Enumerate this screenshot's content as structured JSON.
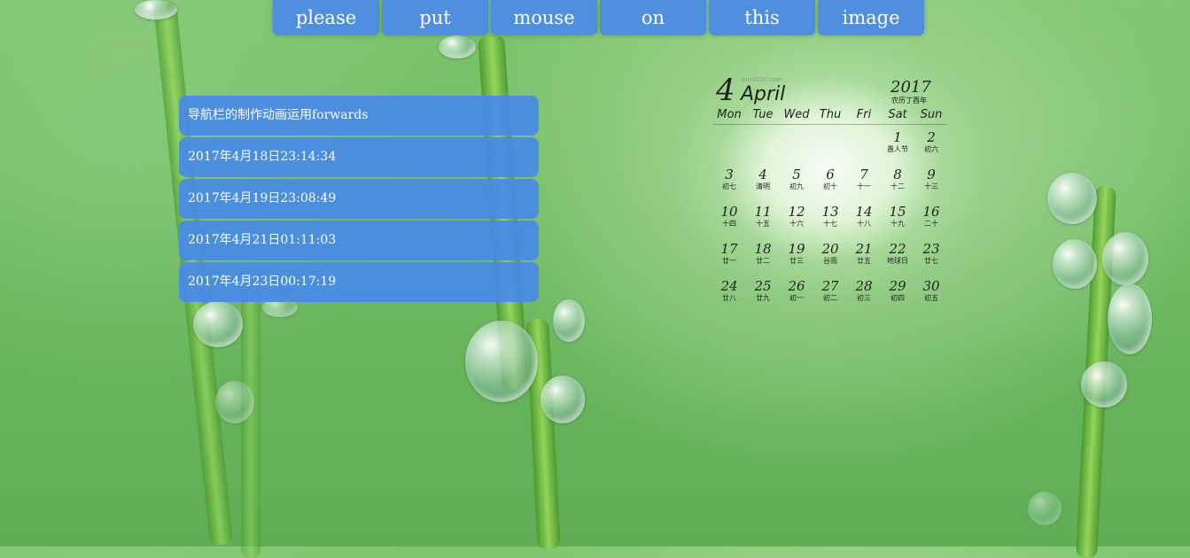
{
  "nav": {
    "buttons": [
      "please",
      "put",
      "mouse",
      "on",
      "this",
      "image"
    ]
  },
  "list": {
    "items": [
      "导航栏的制作动画运用forwards",
      "2017年4月18日23:14:34",
      "2017年4月19日23:08:49",
      "2017年4月21日01:11:03",
      "2017年4月23日00:17:19"
    ]
  },
  "calendar": {
    "month_num": "4",
    "month_name": "April",
    "watermark": "win4000.com",
    "year": "2017",
    "year_sub": "农历丁酉年",
    "weekdays": [
      "Mon",
      "Tue",
      "Wed",
      "Thu",
      "Fri",
      "Sat",
      "Sun"
    ],
    "rows": [
      [
        [
          "",
          ""
        ],
        [
          "",
          ""
        ],
        [
          "",
          ""
        ],
        [
          "",
          ""
        ],
        [
          "",
          ""
        ],
        [
          "1",
          "愚人节"
        ],
        [
          "2",
          "初六"
        ]
      ],
      [
        [
          "3",
          "初七"
        ],
        [
          "4",
          "清明"
        ],
        [
          "5",
          "初九"
        ],
        [
          "6",
          "初十"
        ],
        [
          "7",
          "十一"
        ],
        [
          "8",
          "十二"
        ],
        [
          "9",
          "十三"
        ]
      ],
      [
        [
          "10",
          "十四"
        ],
        [
          "11",
          "十五"
        ],
        [
          "12",
          "十六"
        ],
        [
          "13",
          "十七"
        ],
        [
          "14",
          "十八"
        ],
        [
          "15",
          "十九"
        ],
        [
          "16",
          "二十"
        ]
      ],
      [
        [
          "17",
          "廿一"
        ],
        [
          "18",
          "廿二"
        ],
        [
          "19",
          "廿三"
        ],
        [
          "20",
          "谷雨"
        ],
        [
          "21",
          "廿五"
        ],
        [
          "22",
          "地球日"
        ],
        [
          "23",
          "廿七"
        ]
      ],
      [
        [
          "24",
          "廿八"
        ],
        [
          "25",
          "廿九"
        ],
        [
          "26",
          "初一"
        ],
        [
          "27",
          "初二"
        ],
        [
          "28",
          "初三"
        ],
        [
          "29",
          "初四"
        ],
        [
          "30",
          "初五"
        ]
      ]
    ]
  },
  "colors": {
    "button_blue": "#4f8fe0",
    "list_blue": "#488ae8",
    "background_green": "#6cb85f"
  }
}
